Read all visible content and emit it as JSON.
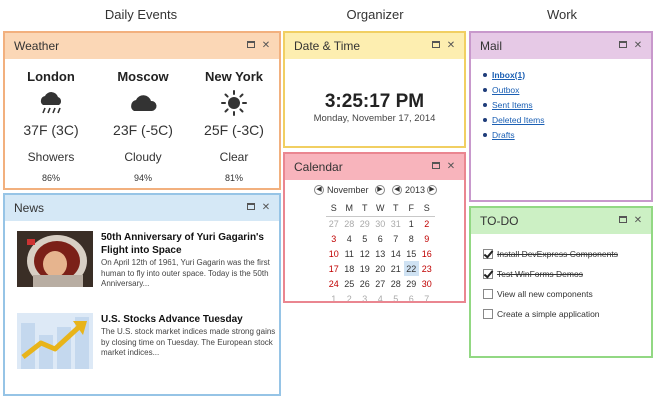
{
  "columns": {
    "daily_events": "Daily Events",
    "organizer": "Organizer",
    "work": "Work"
  },
  "colors": {
    "weather_header": "#fbd7b6",
    "weather_border": "#f2b07e",
    "news_header": "#d5e8f6",
    "news_border": "#96c4e6",
    "datetime_header": "#fdeeb0",
    "datetime_border": "#f1cf62",
    "calendar_header": "#f8b4bc",
    "calendar_border": "#ea8690",
    "mail_header": "#e6c9e6",
    "mail_border": "#c898cc",
    "todo_header": "#ccf0c4",
    "todo_border": "#92d883"
  },
  "panel_controls": {
    "maximize_icon": "maximize-icon",
    "close_glyph": "✕"
  },
  "weather": {
    "title": "Weather",
    "cities": [
      {
        "name": "London",
        "icon": "rain-cloud-icon",
        "temp": "37F (3C)",
        "condition": "Showers",
        "humidity": "86%"
      },
      {
        "name": "Moscow",
        "icon": "cloud-icon",
        "temp": "23F (-5C)",
        "condition": "Cloudy",
        "humidity": "94%"
      },
      {
        "name": "New York",
        "icon": "sun-icon",
        "temp": "25F (-3C)",
        "condition": "Clear",
        "humidity": "81%"
      }
    ]
  },
  "news": {
    "title": "News",
    "items": [
      {
        "headline": "50th Anniversary of Yuri Gagarin's Flight into Space",
        "summary": "On April 12th of 1961, Yuri Gagarin was the first human to fly into outer space. Today is the 50th Anniversary...",
        "image": "astronaut-photo"
      },
      {
        "headline": "U.S. Stocks Advance Tuesday",
        "summary": "The U.S. stock market indices made strong gains by closing time on Tuesday. The European stock market indices...",
        "image": "stock-chart-image"
      }
    ]
  },
  "datetime": {
    "title": "Date & Time",
    "time": "3:25:17 PM",
    "date": "Monday, November 17, 2014"
  },
  "calendar": {
    "title": "Calendar",
    "month": "November",
    "year": "2013",
    "weekdays": [
      "S",
      "M",
      "T",
      "W",
      "T",
      "F",
      "S"
    ],
    "weeks": [
      [
        "27",
        "28",
        "29",
        "30",
        "31",
        "1",
        "2"
      ],
      [
        "3",
        "4",
        "5",
        "6",
        "7",
        "8",
        "9"
      ],
      [
        "10",
        "11",
        "12",
        "13",
        "14",
        "15",
        "16"
      ],
      [
        "17",
        "18",
        "19",
        "20",
        "21",
        "22",
        "23"
      ],
      [
        "24",
        "25",
        "26",
        "27",
        "28",
        "29",
        "30"
      ],
      [
        "1",
        "2",
        "3",
        "4",
        "5",
        "6",
        "7"
      ]
    ],
    "selected": "22"
  },
  "mail": {
    "title": "Mail",
    "folders": [
      "Inbox(1)",
      "Outbox",
      "Sent Items",
      "Deleted Items",
      "Drafts"
    ]
  },
  "todo": {
    "title": "TO-DO",
    "items": [
      {
        "label": "Install DevExpress Components",
        "done": true
      },
      {
        "label": "Test WinForms Demos",
        "done": true
      },
      {
        "label": "View all new components",
        "done": false
      },
      {
        "label": "Create a simple application",
        "done": false
      }
    ]
  }
}
